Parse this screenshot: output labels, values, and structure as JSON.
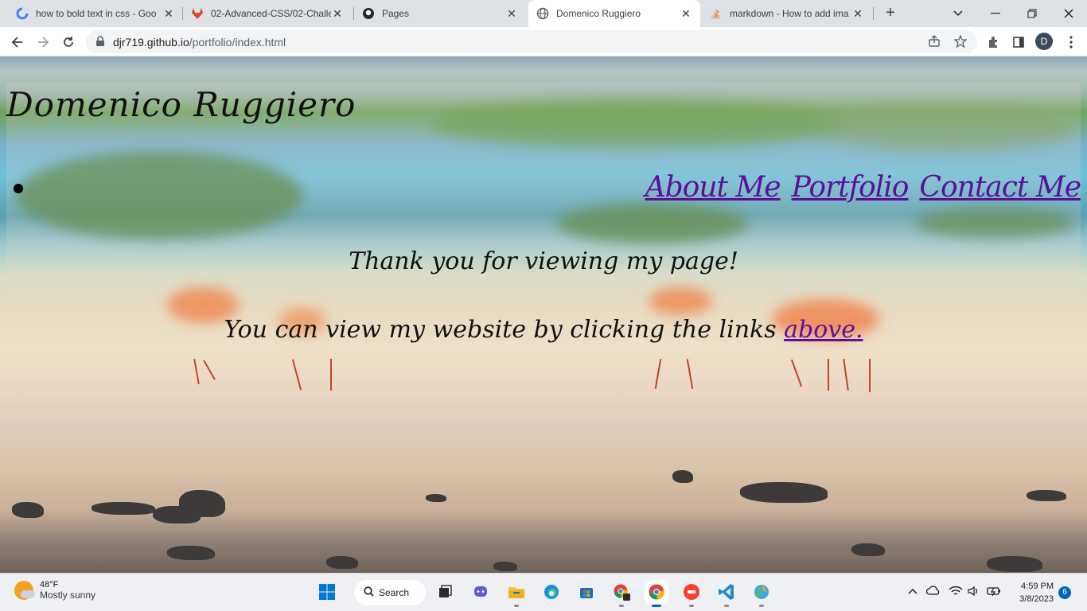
{
  "browser": {
    "tabs": [
      {
        "title": "how to bold text in css - Goo",
        "icon": "google-icon"
      },
      {
        "title": "02-Advanced-CSS/02-Challen",
        "icon": "gitlab-icon"
      },
      {
        "title": "Pages",
        "icon": "github-icon"
      },
      {
        "title": "Domenico Ruggiero",
        "icon": "globe-icon",
        "active": true
      },
      {
        "title": "markdown - How to add ima",
        "icon": "stackoverflow-icon"
      }
    ],
    "new_tab": "+",
    "url_host": "djr719.github.io",
    "url_path": "/portfolio/index.html",
    "profile_initial": "D"
  },
  "page": {
    "site_title": "Domenico Ruggiero",
    "nav": [
      {
        "label": "About Me"
      },
      {
        "label": "Portfolio"
      },
      {
        "label": "Contact Me"
      }
    ],
    "message_1": "Thank you for viewing my page!",
    "message_2_prefix": "You can view my website by clicking the links ",
    "message_2_link": "above."
  },
  "taskbar": {
    "weather_temp": "48°F",
    "weather_condition": "Mostly sunny",
    "search_label": "Search",
    "time": "4:59 PM",
    "date": "3/8/2023",
    "notification_count": "6"
  },
  "colors": {
    "link": "#5b0f9c",
    "accent": "#0067c0"
  }
}
